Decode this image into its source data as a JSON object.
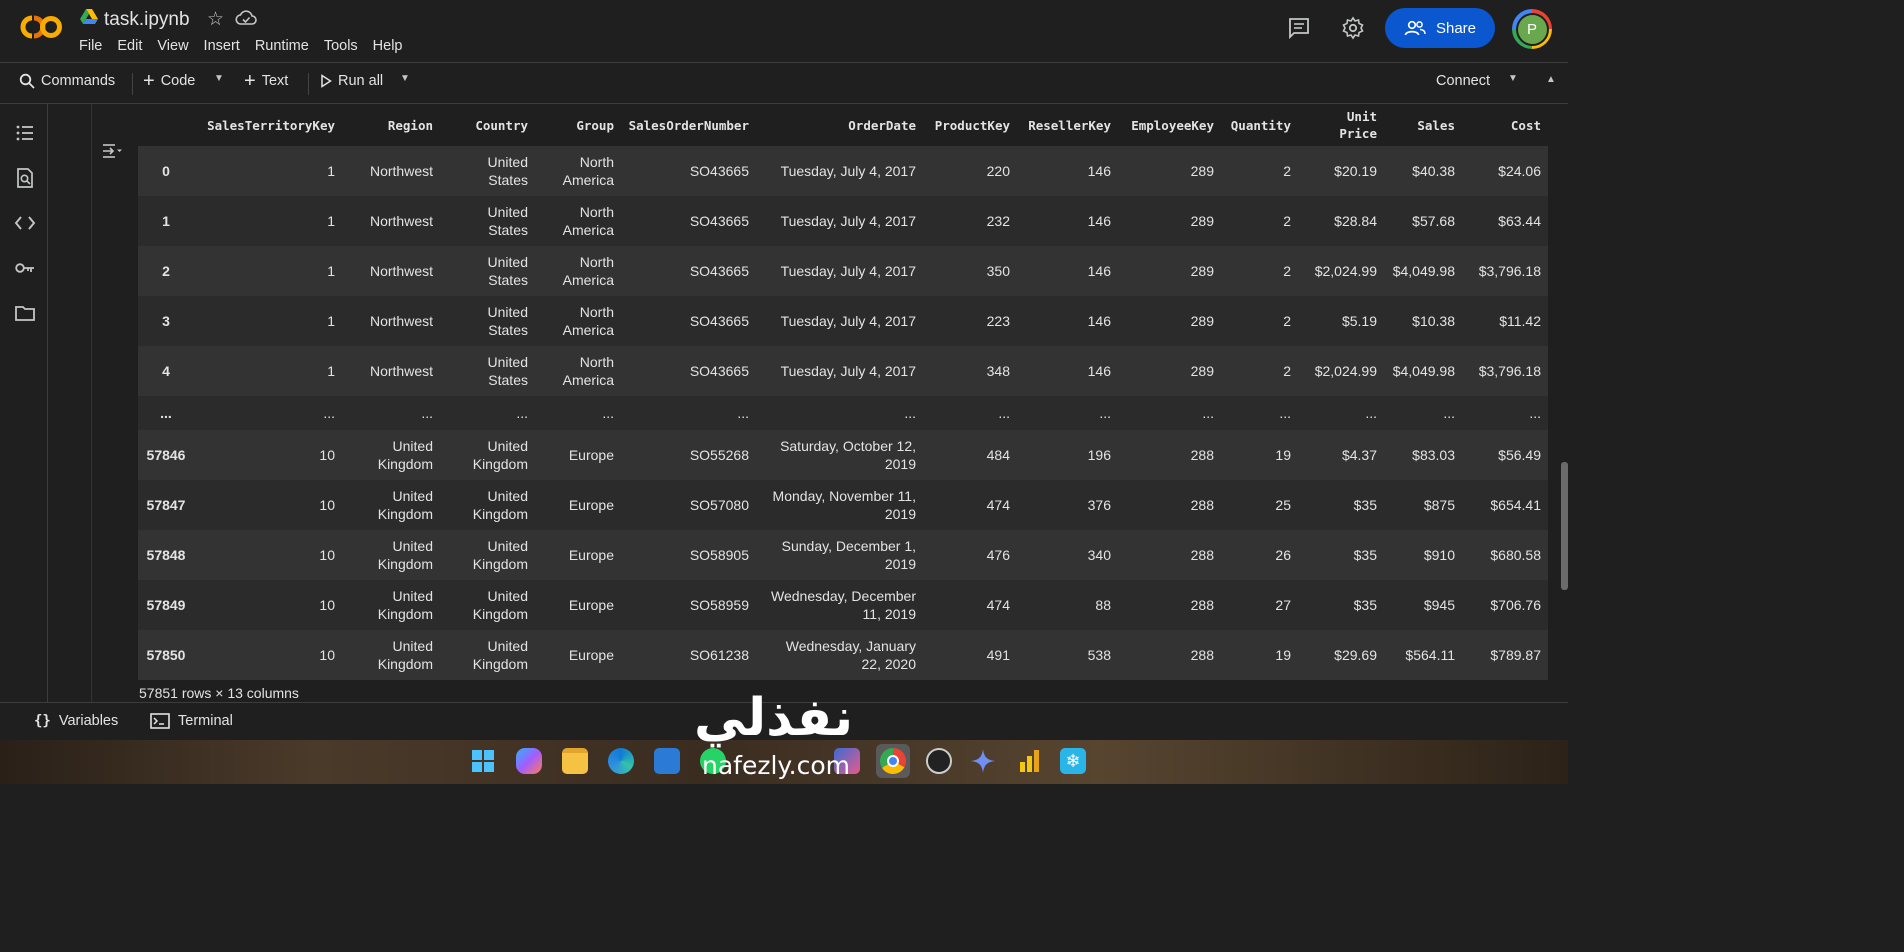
{
  "header": {
    "file_name": "task.ipynb",
    "menu": [
      "File",
      "Edit",
      "View",
      "Insert",
      "Runtime",
      "Tools",
      "Help"
    ],
    "share_label": "Share",
    "avatar_letter": "P"
  },
  "toolbar": {
    "commands_label": "Commands",
    "code_label": "Code",
    "text_label": "Text",
    "run_all_label": "Run all",
    "connect_label": "Connect"
  },
  "table": {
    "columns": [
      "SalesTerritoryKey",
      "Region",
      "Country",
      "Group",
      "SalesOrderNumber",
      "OrderDate",
      "ProductKey",
      "ResellerKey",
      "EmployeeKey",
      "Quantity",
      "Unit Price",
      "Sales",
      "Cost"
    ],
    "rows": [
      {
        "index": "0",
        "cells": [
          "1",
          "Northwest",
          "United States",
          "North America",
          "SO43665",
          "Tuesday, July 4, 2017",
          "220",
          "146",
          "289",
          "2",
          "$20.19",
          "$40.38",
          "$24.06"
        ]
      },
      {
        "index": "1",
        "cells": [
          "1",
          "Northwest",
          "United States",
          "North America",
          "SO43665",
          "Tuesday, July 4, 2017",
          "232",
          "146",
          "289",
          "2",
          "$28.84",
          "$57.68",
          "$63.44"
        ]
      },
      {
        "index": "2",
        "cells": [
          "1",
          "Northwest",
          "United States",
          "North America",
          "SO43665",
          "Tuesday, July 4, 2017",
          "350",
          "146",
          "289",
          "2",
          "$2,024.99",
          "$4,049.98",
          "$3,796.18"
        ]
      },
      {
        "index": "3",
        "cells": [
          "1",
          "Northwest",
          "United States",
          "North America",
          "SO43665",
          "Tuesday, July 4, 2017",
          "223",
          "146",
          "289",
          "2",
          "$5.19",
          "$10.38",
          "$11.42"
        ]
      },
      {
        "index": "4",
        "cells": [
          "1",
          "Northwest",
          "United States",
          "North America",
          "SO43665",
          "Tuesday, July 4, 2017",
          "348",
          "146",
          "289",
          "2",
          "$2,024.99",
          "$4,049.98",
          "$3,796.18"
        ]
      },
      {
        "index": "...",
        "cells": [
          "...",
          "...",
          "...",
          "...",
          "...",
          "...",
          "...",
          "...",
          "...",
          "...",
          "...",
          "...",
          "..."
        ]
      },
      {
        "index": "57846",
        "cells": [
          "10",
          "United Kingdom",
          "United Kingdom",
          "Europe",
          "SO55268",
          "Saturday, October 12, 2019",
          "484",
          "196",
          "288",
          "19",
          "$4.37",
          "$83.03",
          "$56.49"
        ]
      },
      {
        "index": "57847",
        "cells": [
          "10",
          "United Kingdom",
          "United Kingdom",
          "Europe",
          "SO57080",
          "Monday, November 11, 2019",
          "474",
          "376",
          "288",
          "25",
          "$35",
          "$875",
          "$654.41"
        ]
      },
      {
        "index": "57848",
        "cells": [
          "10",
          "United Kingdom",
          "United Kingdom",
          "Europe",
          "SO58905",
          "Sunday, December 1, 2019",
          "476",
          "340",
          "288",
          "26",
          "$35",
          "$910",
          "$680.58"
        ]
      },
      {
        "index": "57849",
        "cells": [
          "10",
          "United Kingdom",
          "United Kingdom",
          "Europe",
          "SO58959",
          "Wednesday, December 11, 2019",
          "474",
          "88",
          "288",
          "27",
          "$35",
          "$945",
          "$706.76"
        ]
      },
      {
        "index": "57850",
        "cells": [
          "10",
          "United Kingdom",
          "United Kingdom",
          "Europe",
          "SO61238",
          "Wednesday, January 22, 2020",
          "491",
          "538",
          "288",
          "19",
          "$29.69",
          "$564.11",
          "$789.87"
        ]
      }
    ],
    "caption": "57851 rows × 13 columns"
  },
  "bottom_bar": {
    "variables_label": "Variables",
    "terminal_label": "Terminal"
  },
  "watermark": {
    "arabic": "نفذلي",
    "latin": "nafezly.com"
  },
  "colors": {
    "background": "#1f1f1f",
    "share_button": "#0b57d0",
    "row_odd": "#333333",
    "row_even": "#2b2b2b"
  },
  "icons": {
    "left_rail": [
      "table-of-contents-icon",
      "find-replace-icon",
      "code-snippets-icon",
      "secrets-key-icon",
      "files-folder-icon"
    ],
    "taskbar": [
      "windows-start-icon",
      "copilot-icon",
      "file-explorer-icon",
      "edge-icon",
      "store-icon",
      "whatsapp-icon",
      "photos-icon",
      "chrome-icon",
      "chatgpt-icon",
      "gemini-icon",
      "power-bi-icon",
      "snowflake-icon"
    ]
  }
}
